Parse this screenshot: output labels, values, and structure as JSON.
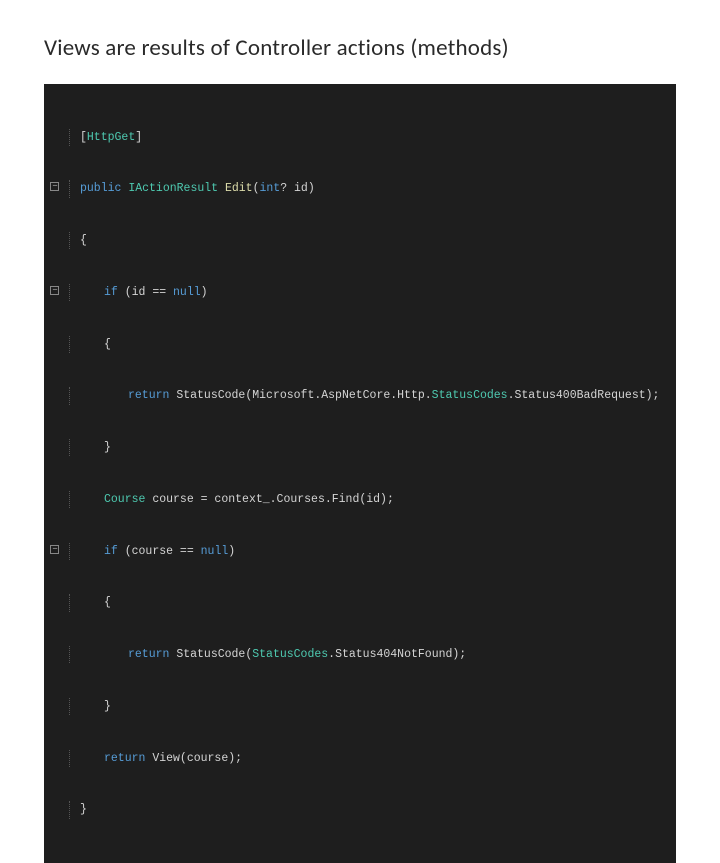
{
  "title": "Views are results of Controller actions (methods)",
  "code": {
    "l0_attr_name": "HttpGet",
    "l1_public": "public",
    "l1_type": "IActionResult",
    "l1_name": "Edit",
    "l1_params_open": "(",
    "l1_param_type": "int",
    "l1_param_nullable": "?",
    "l1_param_name": " id",
    "l1_params_close": ")",
    "l2_brace": "{",
    "l3_if": "if",
    "l3_cond": " (id == ",
    "l3_null": "null",
    "l3_close": ")",
    "l4_brace": "{",
    "l5_return": "return",
    "l5_call": " StatusCode(Microsoft.AspNetCore.Http.",
    "l5_class": "StatusCodes",
    "l5_member": ".Status400BadRequest);",
    "l6_brace": "}",
    "l7_type": "Course",
    "l7_rest": " course = context_.Courses.Find(id);",
    "l8_if": "if",
    "l8_cond": " (course == ",
    "l8_null": "null",
    "l8_close": ")",
    "l9_brace": "{",
    "l10_return": "return",
    "l10_call": " StatusCode(",
    "l10_class": "StatusCodes",
    "l10_member": ".Status404NotFound);",
    "l11_brace": "}",
    "l12_return": "return",
    "l12_call": " View(course);",
    "l13_brace": "}"
  }
}
